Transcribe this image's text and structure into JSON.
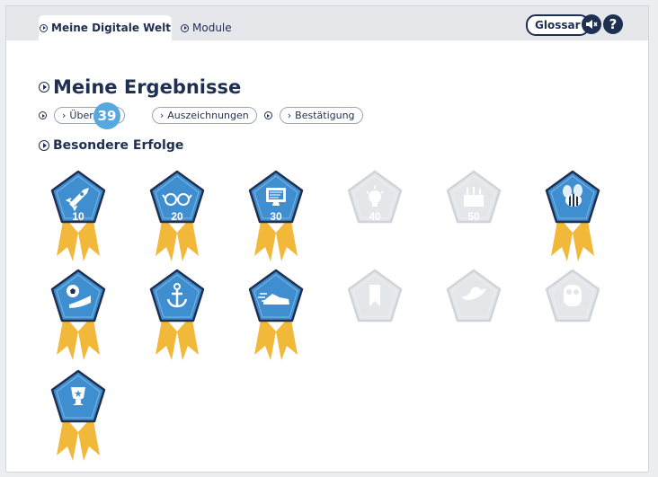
{
  "header": {
    "tabs": [
      {
        "label": "Meine Digitale Welt",
        "active": true
      },
      {
        "label": "Module",
        "active": false
      }
    ],
    "glossar_label": "Glossar",
    "sound_icon": "speaker-icon",
    "help_icon": "help-icon",
    "help_glyph": "?"
  },
  "page": {
    "title": "Meine Ergebnisse",
    "breadcrumbs": [
      {
        "label": "Übersicht"
      },
      {
        "label": "Auszeichnungen"
      },
      {
        "label": "Bestätigung"
      }
    ],
    "badge_count": "39",
    "section_title": "Besondere Erfolge"
  },
  "colors": {
    "navy": "#1f2f52",
    "badge_blue": "#56a8df",
    "award_blue": "#3e8ed0",
    "award_ribbon": "#f1b83a",
    "locked_grey": "#e4e6ea"
  },
  "awards": [
    {
      "icon": "rocket-icon",
      "label": "10",
      "earned": true
    },
    {
      "icon": "glasses-icon",
      "label": "20",
      "earned": true
    },
    {
      "icon": "computer-screen-icon",
      "label": "30",
      "earned": true
    },
    {
      "icon": "lightbulb-icon",
      "label": "40",
      "earned": false
    },
    {
      "icon": "toolbox-icon",
      "label": "50",
      "earned": false
    },
    {
      "icon": "bee-icon",
      "label": "",
      "earned": true
    },
    {
      "icon": "soccer-ball-shoe-icon",
      "label": "",
      "earned": true
    },
    {
      "icon": "anchor-icon",
      "label": "",
      "earned": true
    },
    {
      "icon": "running-shoe-icon",
      "label": "",
      "earned": true
    },
    {
      "icon": "bookmark-icon",
      "label": "",
      "earned": false
    },
    {
      "icon": "bird-icon",
      "label": "",
      "earned": false
    },
    {
      "icon": "owl-icon",
      "label": "",
      "earned": false
    },
    {
      "icon": "trophy-icon",
      "label": "",
      "earned": true
    }
  ]
}
